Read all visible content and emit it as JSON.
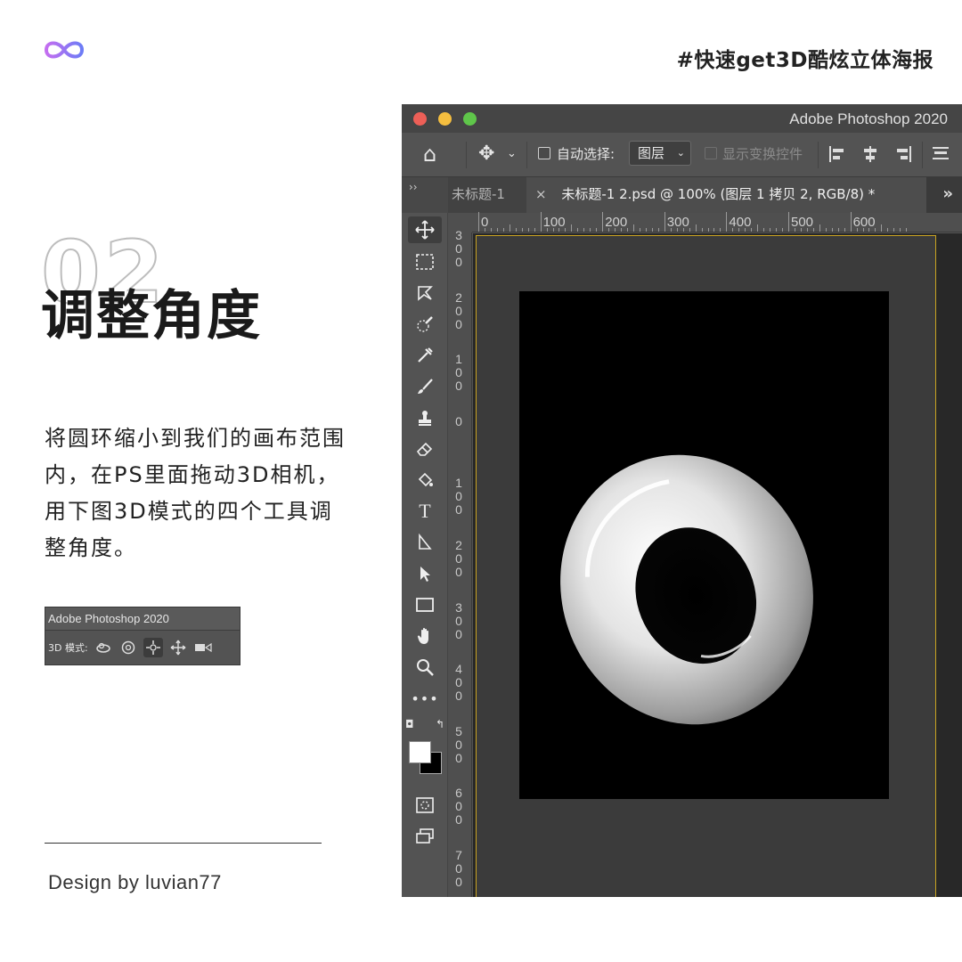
{
  "poster": {
    "hashtag": "#快速get3D酷炫立体海报",
    "step_number": "02",
    "step_title": "调整角度",
    "description": "将圆环缩小到我们的画布范围内，在PS里面拖动3D相机，用下图3D模式的四个工具调整角度。",
    "credit": "Design by luvian77",
    "accent_colors": [
      "#8a7cf6",
      "#c46ef0"
    ]
  },
  "mini_ps": {
    "title": "Adobe Photoshop 2020",
    "mode_label": "3D 模式:",
    "icons": [
      "rotate-3d-icon",
      "roll-3d-icon",
      "pan-3d-icon",
      "slide-3d-icon",
      "scale-3d-icon"
    ]
  },
  "photoshop": {
    "title": "Adobe Photoshop 2020",
    "options": {
      "auto_select_label": "自动选择:",
      "layer_select_value": "图层",
      "show_transform_label": "显示变换控件"
    },
    "tabs": {
      "inactive": "未标题-1",
      "active": "未标题-1 2.psd @ 100% (图层 1 拷贝 2, RGB/8) *",
      "close": "×",
      "more": "»"
    },
    "tools_collapse": "››",
    "ruler_h": [
      "0",
      "100",
      "200",
      "300",
      "400",
      "500",
      "600"
    ],
    "ruler_v": [
      "300",
      "200",
      "100",
      "0",
      "100",
      "200",
      "300",
      "400",
      "500",
      "600",
      "700"
    ],
    "tools": [
      "move-icon",
      "marquee-icon",
      "lasso-icon",
      "quick-select-icon",
      "eyedropper-icon",
      "brush-icon",
      "stamp-icon",
      "eraser-icon",
      "paint-bucket-icon",
      "type-icon",
      "path-select-icon",
      "direct-select-icon",
      "rectangle-icon",
      "hand-icon",
      "zoom-icon",
      "more-tools-icon"
    ]
  }
}
